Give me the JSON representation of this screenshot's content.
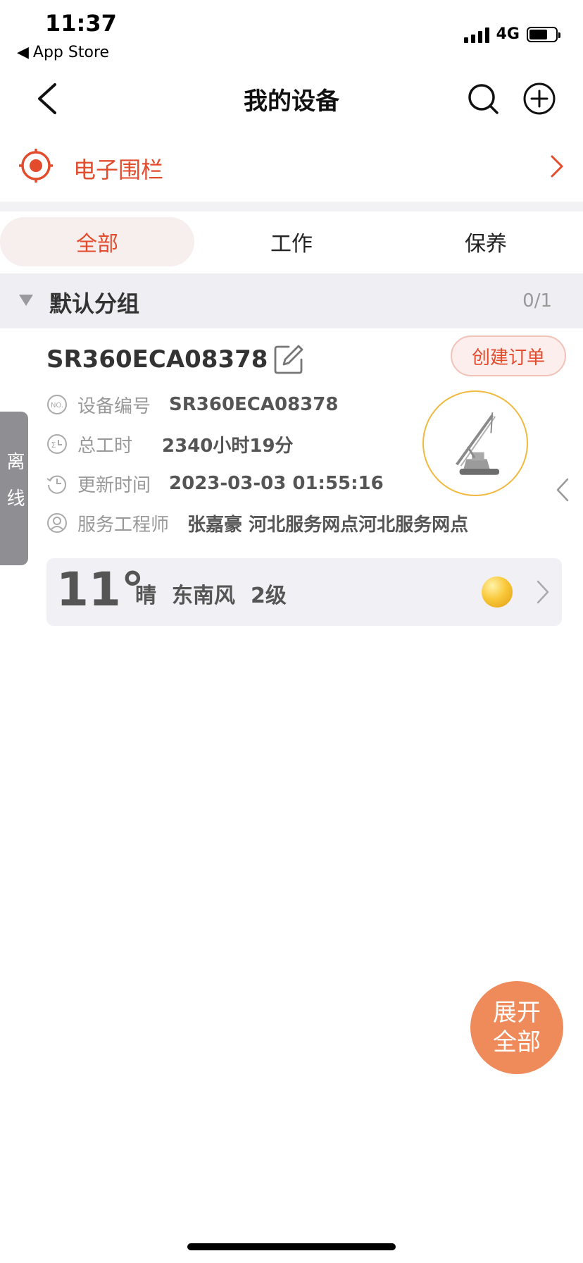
{
  "status_bar": {
    "time": "11:37",
    "back_app": "App Store",
    "network": "4G"
  },
  "nav": {
    "title": "我的设备"
  },
  "fence": {
    "label": "电子围栏",
    "color": "#e34b2d"
  },
  "tabs": [
    {
      "label": "全部",
      "active": true
    },
    {
      "label": "工作",
      "active": false
    },
    {
      "label": "保养",
      "active": false
    }
  ],
  "group": {
    "title": "默认分组",
    "count": "0/1"
  },
  "device": {
    "id": "SR360ECA08378",
    "order_button": "创建订单",
    "status": "离线",
    "rows": [
      {
        "icon": "number-icon",
        "label": "设备编号",
        "value": "SR360ECA08378"
      },
      {
        "icon": "timer-icon",
        "label": "总工时",
        "value": "2340小时19分"
      },
      {
        "icon": "history-icon",
        "label": "更新时间",
        "value": "2023-03-03 01:55:16"
      },
      {
        "icon": "person-icon",
        "label": "服务工程师",
        "value": "张嘉豪  河北服务网点河北服务网点"
      }
    ]
  },
  "weather": {
    "temp": "11°",
    "condition": "晴",
    "wind": "东南风",
    "level": "2级",
    "icon": "sun-icon"
  },
  "fab": {
    "line1": "展开",
    "line2": "全部"
  },
  "colors": {
    "accent": "#e34b2d",
    "fab": "#ef8a5a",
    "offline": "#8f8f93",
    "ring": "#f0b940"
  }
}
